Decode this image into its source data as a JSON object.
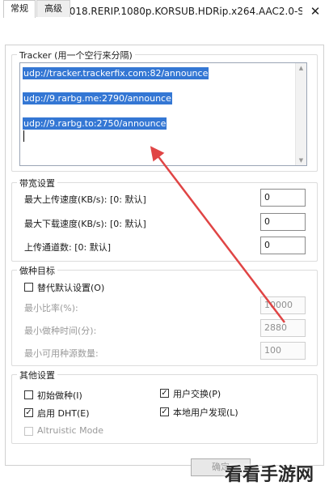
{
  "window": {
    "title": "Bumblebee.2018.RERIP.1080p.KORSUB.HDRip.x264.AAC2.0-STUTTER...",
    "close_glyph": "✕"
  },
  "tabs": [
    {
      "label": "常规",
      "active": true
    },
    {
      "label": "高级",
      "active": false
    }
  ],
  "tracker": {
    "group_title": "Tracker (用一个空行来分隔)",
    "lines": [
      "udp://tracker.trackerfix.com:82/announce",
      "udp://9.rarbg.me:2790/announce",
      "udp://9.rarbg.to:2750/announce"
    ]
  },
  "bandwidth": {
    "group_title": "带宽设置",
    "rows": [
      {
        "label": "最大上传速度(KB/s): [0: 默认]",
        "value": "0"
      },
      {
        "label": "最大下载速度(KB/s): [0: 默认]",
        "value": "0"
      },
      {
        "label": "上传通道数: [0: 默认]",
        "value": "0"
      }
    ]
  },
  "seeding": {
    "group_title": "做种目标",
    "override_label": "替代默认设置(O)",
    "override_checked": false,
    "rows": [
      {
        "label": "最小比率(%):",
        "value": "10000"
      },
      {
        "label": "最小做种时间(分):",
        "value": "2880"
      },
      {
        "label": "最小可用种源数量:",
        "value": "100"
      }
    ]
  },
  "other": {
    "group_title": "其他设置",
    "options": [
      {
        "label": "初始做种(I)",
        "checked": false,
        "enabled": true
      },
      {
        "label": "用户交换(P)",
        "checked": true,
        "enabled": true
      },
      {
        "label": "启用 DHT(E)",
        "checked": true,
        "enabled": true
      },
      {
        "label": "本地用户发现(L)",
        "checked": true,
        "enabled": true
      },
      {
        "label": "Altruistic Mode",
        "checked": false,
        "enabled": false
      }
    ]
  },
  "footer": {
    "ok_label": "确定"
  },
  "watermark": {
    "text": "看看手游网"
  },
  "colors": {
    "selection": "#3477d4",
    "annotation_arrow": "#e04545"
  },
  "icons": {
    "check": "✓"
  }
}
